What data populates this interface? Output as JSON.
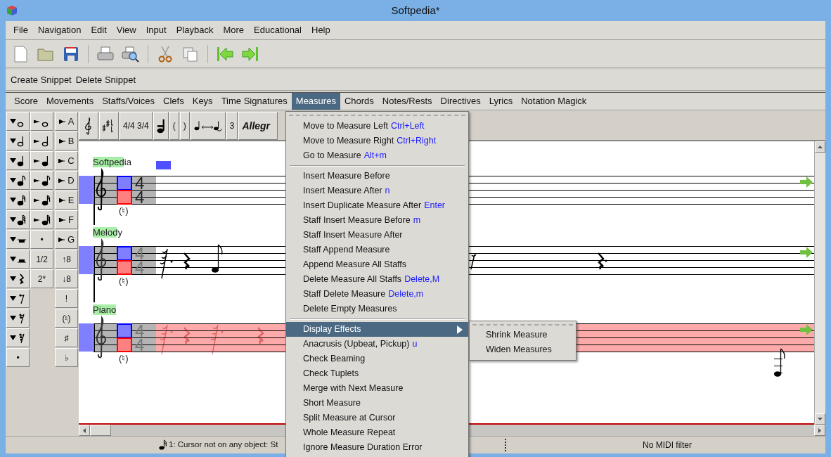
{
  "window": {
    "title": "Softpedia*"
  },
  "menu_bar": [
    "File",
    "Navigation",
    "Edit",
    "View",
    "Input",
    "Playback",
    "More",
    "Educational",
    "Help"
  ],
  "snippet_bar": [
    "Create Snippet",
    "Delete Snippet"
  ],
  "tabs": [
    {
      "label": "Score",
      "selected": false
    },
    {
      "label": "Movements",
      "selected": false
    },
    {
      "label": "Staffs/Voices",
      "selected": false
    },
    {
      "label": "Clefs",
      "selected": false
    },
    {
      "label": "Keys",
      "selected": false
    },
    {
      "label": "Time Signatures",
      "selected": false
    },
    {
      "label": "Measures",
      "selected": true
    },
    {
      "label": "Chords",
      "selected": false
    },
    {
      "label": "Notes/Rests",
      "selected": false
    },
    {
      "label": "Directives",
      "selected": false
    },
    {
      "label": "Lyrics",
      "selected": false
    },
    {
      "label": "Notation Magick",
      "selected": false
    }
  ],
  "palette": [
    [
      {
        "kind": "insert-whole-note"
      },
      {
        "kind": "insert-half-note"
      },
      {
        "kind": "insert-quarter-note"
      },
      {
        "kind": "insert-eighth-note"
      },
      {
        "kind": "insert-sixteenth-note"
      },
      {
        "kind": "insert-thirtysecond-note"
      },
      {
        "kind": "insert-whole-rest"
      },
      {
        "kind": "insert-half-rest"
      },
      {
        "kind": "insert-quarter-rest"
      },
      {
        "kind": "insert-eighth-rest"
      },
      {
        "kind": "insert-sixteenth-rest"
      },
      {
        "kind": "insert-thirtysecond-rest"
      },
      {
        "kind": "text",
        "label": "•"
      }
    ],
    [
      {
        "kind": "change-whole-note"
      },
      {
        "kind": "change-half-note"
      },
      {
        "kind": "change-quarter-note"
      },
      {
        "kind": "change-eighth-note"
      },
      {
        "kind": "change-sixteenth-note"
      },
      {
        "kind": "change-thirtysecond-note"
      },
      {
        "kind": "text",
        "label": "•"
      },
      {
        "kind": "text",
        "label": "1/2"
      },
      {
        "kind": "text",
        "label": "2*"
      },
      {
        "kind": "empty"
      },
      {
        "kind": "empty"
      },
      {
        "kind": "empty"
      },
      {
        "kind": "empty"
      }
    ],
    [
      {
        "kind": "pitch",
        "label": "A"
      },
      {
        "kind": "pitch",
        "label": "B"
      },
      {
        "kind": "pitch",
        "label": "C"
      },
      {
        "kind": "pitch",
        "label": "D"
      },
      {
        "kind": "pitch",
        "label": "E"
      },
      {
        "kind": "pitch",
        "label": "F"
      },
      {
        "kind": "pitch",
        "label": "G"
      },
      {
        "kind": "text",
        "label": "↑8"
      },
      {
        "kind": "text",
        "label": "↓8"
      },
      {
        "kind": "text",
        "label": "!"
      },
      {
        "kind": "text",
        "label": "(♮)"
      },
      {
        "kind": "text",
        "label": "♯"
      },
      {
        "kind": "text",
        "label": "♭"
      }
    ]
  ],
  "score_toolbar": [
    {
      "kind": "clef"
    },
    {
      "kind": "key-signature"
    },
    {
      "kind": "text",
      "label": "4/4 3/4"
    },
    {
      "kind": "note"
    },
    {
      "kind": "text",
      "label": "("
    },
    {
      "kind": "text",
      "label": ")"
    },
    {
      "kind": "tie"
    },
    {
      "kind": "text",
      "label": "3"
    },
    {
      "kind": "tempo",
      "label": "Allegr"
    }
  ],
  "staves": [
    {
      "name": "Softpedia",
      "kind": "empty",
      "active": true,
      "selected": false,
      "time_signature": [
        "4",
        "4"
      ],
      "accidental": "(♮)"
    },
    {
      "name": "Melody",
      "kind": "melody",
      "active": false,
      "selected": false,
      "time_signature": [
        "4",
        "4"
      ],
      "accidental": "(♮)"
    },
    {
      "name": "Piano",
      "kind": "accompaniment",
      "active": false,
      "selected": true,
      "time_signature": [
        "4",
        "4"
      ],
      "accidental": "(♮)"
    }
  ],
  "measures_menu": [
    {
      "kind": "item",
      "label": "Move to Measure Left",
      "shortcut": "Ctrl+Left",
      "selected": false
    },
    {
      "kind": "item",
      "label": "Move to Measure Right",
      "shortcut": "Ctrl+Right",
      "selected": false
    },
    {
      "kind": "item",
      "label": "Go to Measure",
      "shortcut": "Alt+m",
      "selected": false
    },
    {
      "kind": "separator"
    },
    {
      "kind": "item",
      "label": "Insert Measure Before",
      "selected": false
    },
    {
      "kind": "item",
      "label": "Insert Measure After",
      "shortcut": "n",
      "selected": false
    },
    {
      "kind": "item",
      "label": "Insert Duplicate Measure After",
      "shortcut": "Enter",
      "selected": false
    },
    {
      "kind": "item",
      "label": "Staff Insert Measure Before",
      "shortcut": "m",
      "selected": false
    },
    {
      "kind": "item",
      "label": "Staff Insert Measure After",
      "selected": false
    },
    {
      "kind": "item",
      "label": "Staff Append Measure",
      "selected": false
    },
    {
      "kind": "item",
      "label": "Append Measure All Staffs",
      "selected": false
    },
    {
      "kind": "item",
      "label": "Delete Measure All Staffs",
      "shortcut": "Delete,M",
      "selected": false
    },
    {
      "kind": "item",
      "label": "Staff Delete Measure",
      "shortcut": "Delete,m",
      "selected": false
    },
    {
      "kind": "item",
      "label": "Delete Empty Measures",
      "selected": false
    },
    {
      "kind": "separator"
    },
    {
      "kind": "item",
      "label": "Display Effects",
      "selected": true,
      "submenu": [
        "Shrink Measure",
        "Widen Measures"
      ]
    },
    {
      "kind": "item",
      "label": "Anacrusis (Upbeat, Pickup)",
      "shortcut": "u",
      "selected": false
    },
    {
      "kind": "item",
      "label": "Check Beaming",
      "selected": false
    },
    {
      "kind": "item",
      "label": "Check Tuplets",
      "selected": false
    },
    {
      "kind": "item",
      "label": "Merge with Next Measure",
      "selected": false
    },
    {
      "kind": "item",
      "label": "Short Measure",
      "selected": false
    },
    {
      "kind": "item",
      "label": "Split Measure at Cursor",
      "selected": false
    },
    {
      "kind": "item",
      "label": "Whole Measure Repeat",
      "selected": false
    },
    {
      "kind": "item",
      "label": "Ignore Measure Duration Error",
      "selected": false
    }
  ],
  "status_bar": {
    "message": "1: Cursor not on any object:  St",
    "midi_filter": "No MIDI filter"
  }
}
